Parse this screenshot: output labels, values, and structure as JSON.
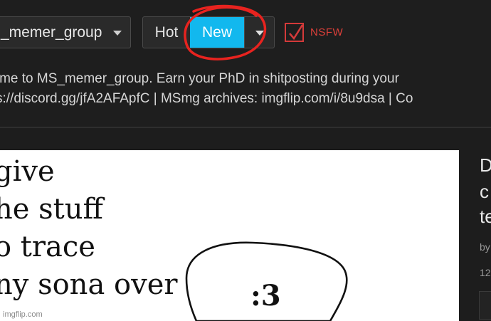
{
  "header": {
    "stream_name": "_memer_group",
    "sort": {
      "hot_label": "Hot",
      "new_label": "New",
      "active": "New"
    },
    "nsfw": {
      "label": "NSFW",
      "checked": true
    },
    "description_line1": "come to MS_memer_group. Earn your PhD in shitposting during your",
    "description_line2": "s://discord.gg/jfA2AFApfC | MSmg archives: imgflip.com/i/8u9dsa | Co"
  },
  "meme": {
    "lines": [
      "give",
      "he stuff",
      "o trace",
      "ny sona over"
    ],
    "face_text": ":3",
    "watermark": "imgflip.com"
  },
  "sidebar_preview": {
    "title_lines": [
      "D",
      "c",
      "te"
    ],
    "meta_by": "by",
    "meta_count": "12"
  },
  "colors": {
    "accent_blue": "#12b8ee",
    "nsfw_red": "#e0403a",
    "annotation_red": "#e8231f",
    "background": "#1e1e1e"
  },
  "icons": [
    "chevron-down-icon",
    "checkmark-icon"
  ]
}
